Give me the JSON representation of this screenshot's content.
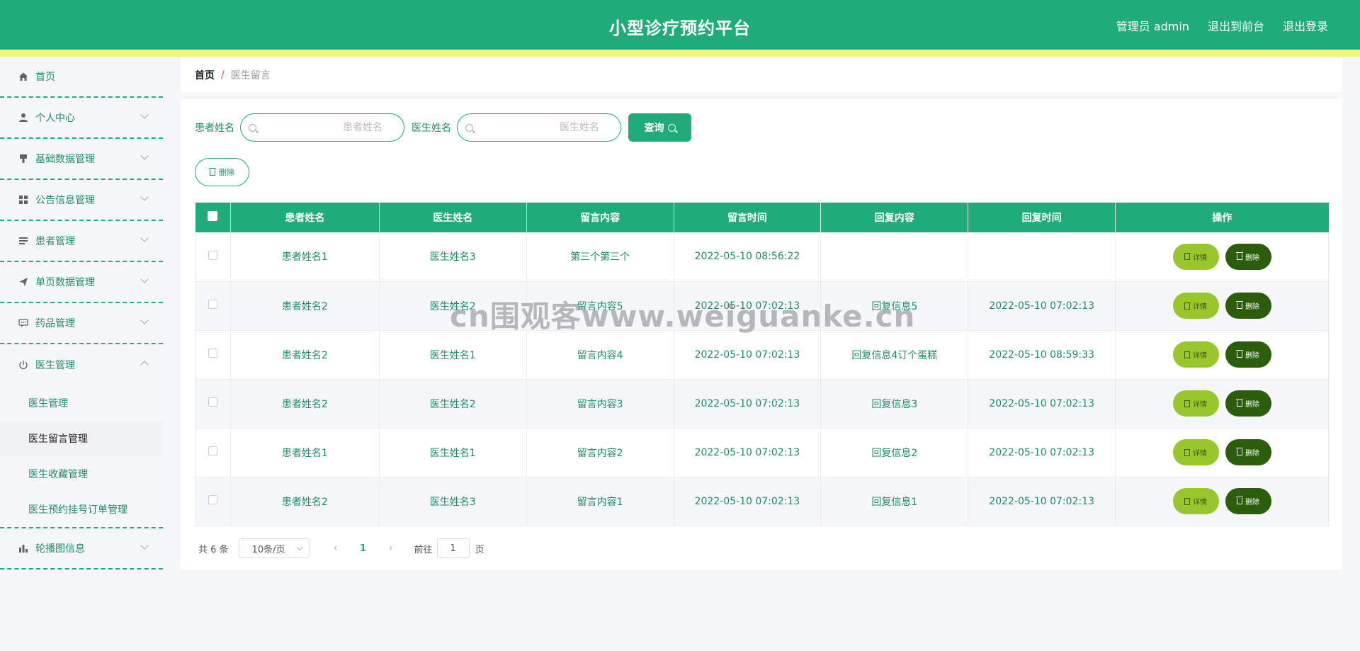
{
  "header": {
    "title": "小型诊疗预约平台",
    "admin_label": "管理员 admin",
    "to_front_label": "退出到前台",
    "logout_label": "退出登录"
  },
  "sidebar": {
    "items": [
      {
        "label": "首页",
        "icon": "home-icon"
      },
      {
        "label": "个人中心",
        "icon": "user-icon"
      },
      {
        "label": "基础数据管理",
        "icon": "brush-icon"
      },
      {
        "label": "公告信息管理",
        "icon": "grid-icon"
      },
      {
        "label": "患者管理",
        "icon": "list-icon"
      },
      {
        "label": "单页数据管理",
        "icon": "send-icon"
      },
      {
        "label": "药品管理",
        "icon": "chat-icon"
      },
      {
        "label": "医生管理",
        "icon": "power-icon"
      },
      {
        "label": "轮播图信息",
        "icon": "bar-chart-icon"
      }
    ],
    "doctor_sub": [
      "医生管理",
      "医生留言管理",
      "医生收藏管理",
      "医生预约挂号订单管理"
    ]
  },
  "breadcrumb": {
    "home": "首页",
    "sep": "/",
    "current": "医生留言"
  },
  "search": {
    "patient_label": "患者姓名",
    "patient_placeholder": "患者姓名",
    "doctor_label": "医生姓名",
    "doctor_placeholder": "医生姓名",
    "query_label": "查询"
  },
  "bulk_delete_label": "删除",
  "table": {
    "headers": [
      "患者姓名",
      "医生姓名",
      "留言内容",
      "留言时间",
      "回复内容",
      "回复时间",
      "操作"
    ],
    "rows": [
      [
        "患者姓名1",
        "医生姓名3",
        "第三个第三个",
        "2022-05-10 08:56:22",
        "",
        ""
      ],
      [
        "患者姓名2",
        "医生姓名2",
        "留言内容5",
        "2022-05-10 07:02:13",
        "回复信息5",
        "2022-05-10 07:02:13"
      ],
      [
        "患者姓名2",
        "医生姓名1",
        "留言内容4",
        "2022-05-10 07:02:13",
        "回复信息4订个蛋糕",
        "2022-05-10 08:59:33"
      ],
      [
        "患者姓名2",
        "医生姓名2",
        "留言内容3",
        "2022-05-10 07:02:13",
        "回复信息3",
        "2022-05-10 07:02:13"
      ],
      [
        "患者姓名1",
        "医生姓名1",
        "留言内容2",
        "2022-05-10 07:02:13",
        "回复信息2",
        "2022-05-10 07:02:13"
      ],
      [
        "患者姓名2",
        "医生姓名3",
        "留言内容1",
        "2022-05-10 07:02:13",
        "回复信息1",
        "2022-05-10 07:02:13"
      ]
    ],
    "detail_label": "详情",
    "delete_label": "删除"
  },
  "pagination": {
    "total": "共 6 条",
    "page_size": "10条/页",
    "current_page": "1",
    "goto_label": "前往",
    "goto_value": "1",
    "page_suffix": "页"
  },
  "watermark": "cn围观客www.weiguanke.cn",
  "colors": {
    "primary": "#1fac7a",
    "stripe": "#eef77a",
    "detail_btn": "#97c72a",
    "delete_btn": "#2b5d0b"
  }
}
